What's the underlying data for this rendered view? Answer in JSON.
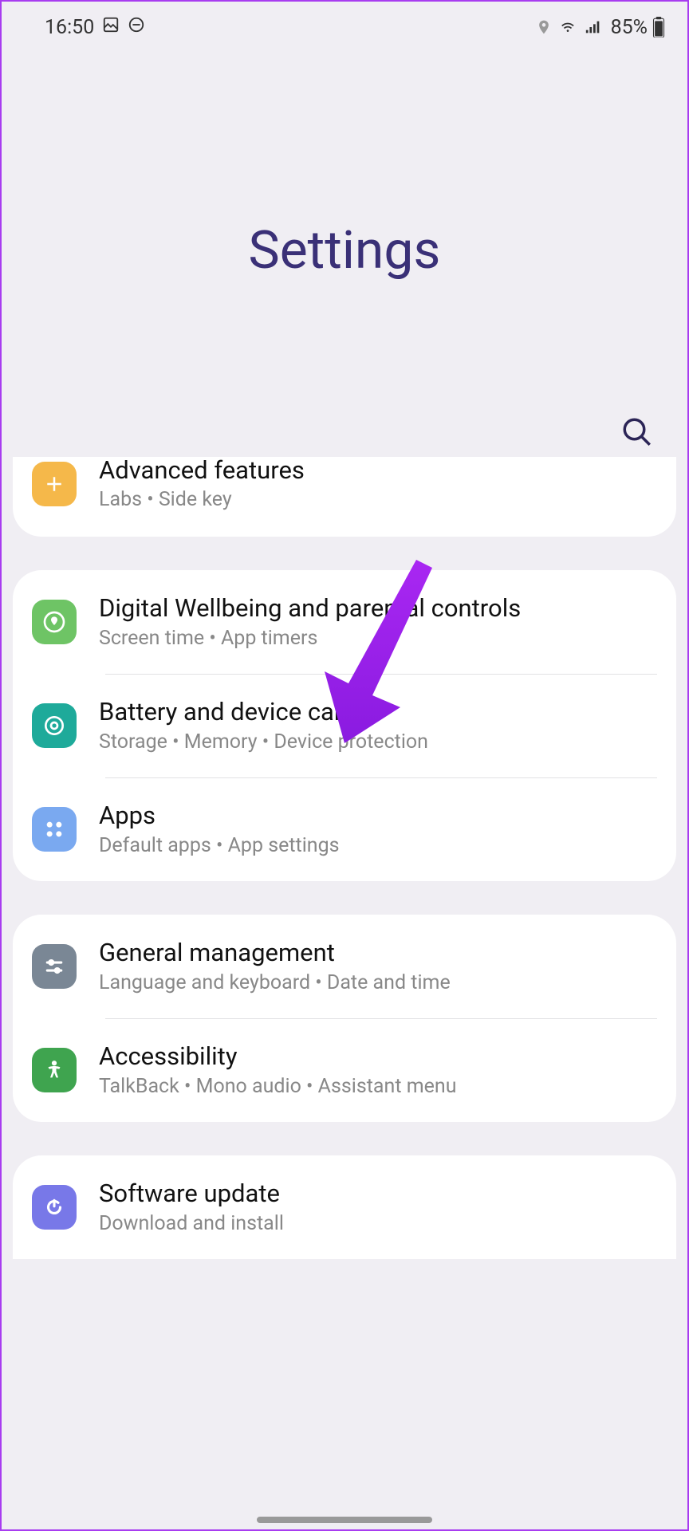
{
  "statusbar": {
    "time": "16:50",
    "battery": "85%"
  },
  "page": {
    "title": "Settings"
  },
  "items": {
    "advanced": {
      "title": "Advanced features",
      "sub": "Labs  •  Side key"
    },
    "wellbeing": {
      "title": "Digital Wellbeing and parental controls",
      "sub": "Screen time  •  App timers"
    },
    "battery": {
      "title": "Battery and device care",
      "sub": "Storage  •  Memory  •  Device protection"
    },
    "apps": {
      "title": "Apps",
      "sub": "Default apps  •  App settings"
    },
    "general": {
      "title": "General management",
      "sub": "Language and keyboard  •  Date and time"
    },
    "accessibility": {
      "title": "Accessibility",
      "sub": "TalkBack  •  Mono audio  •  Assistant menu"
    },
    "software": {
      "title": "Software update",
      "sub": "Download and install"
    }
  }
}
